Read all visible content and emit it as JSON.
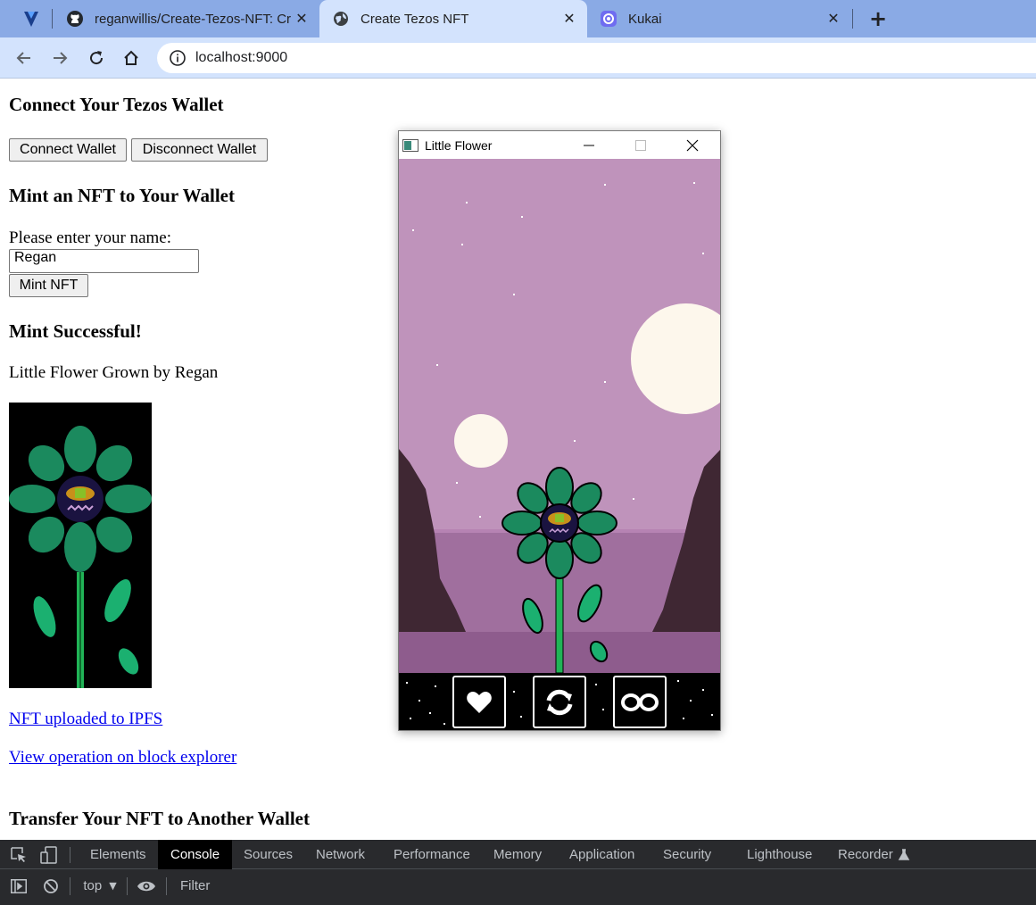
{
  "browser": {
    "tabs": [
      {
        "title": "reganwillis/Create-Tezos-NFT: Cr",
        "favicon": "github-icon",
        "active": false
      },
      {
        "title": "Create Tezos NFT",
        "favicon": "globe-icon",
        "active": true
      },
      {
        "title": "Kukai",
        "favicon": "kukai-icon",
        "active": false
      }
    ],
    "new_tab_label": "+",
    "url": "localhost:9000",
    "colors": {
      "tabstrip": "#8aaae5",
      "active_tab": "#d3e3fd",
      "toolbar": "#d3e3fd"
    }
  },
  "page": {
    "connect_heading": "Connect Your Tezos Wallet",
    "connect_button": "Connect Wallet",
    "disconnect_button": "Disconnect Wallet",
    "mint_heading": "Mint an NFT to Your Wallet",
    "name_label": "Please enter your name:",
    "name_value": "Regan",
    "mint_button": "Mint NFT",
    "success_heading": "Mint Successful!",
    "nft_title": "Little Flower Grown by Regan",
    "ipfs_link": "NFT uploaded to IPFS",
    "explorer_link": "View operation on block explorer",
    "transfer_heading": "Transfer Your NFT to Another Wallet",
    "link_color": "#0000ee"
  },
  "game_window": {
    "title": "Little Flower",
    "controls": [
      {
        "name": "heart-button",
        "icon": "heart-icon"
      },
      {
        "name": "refresh-button",
        "icon": "refresh-icon"
      },
      {
        "name": "infinity-button",
        "icon": "infinity-icon"
      }
    ],
    "colors": {
      "sky": "#bf93bb",
      "moon": "#fdf7ec",
      "cliff": "#3f2733",
      "water": "#a06f9e",
      "petal": "#1b8a5e",
      "stem": "#21b457"
    }
  },
  "devtools": {
    "tabs": [
      "Elements",
      "Console",
      "Sources",
      "Network",
      "Performance",
      "Memory",
      "Application",
      "Security",
      "Lighthouse",
      "Recorder"
    ],
    "active_tab": "Console",
    "context": "top",
    "filter_placeholder": "Filter"
  }
}
